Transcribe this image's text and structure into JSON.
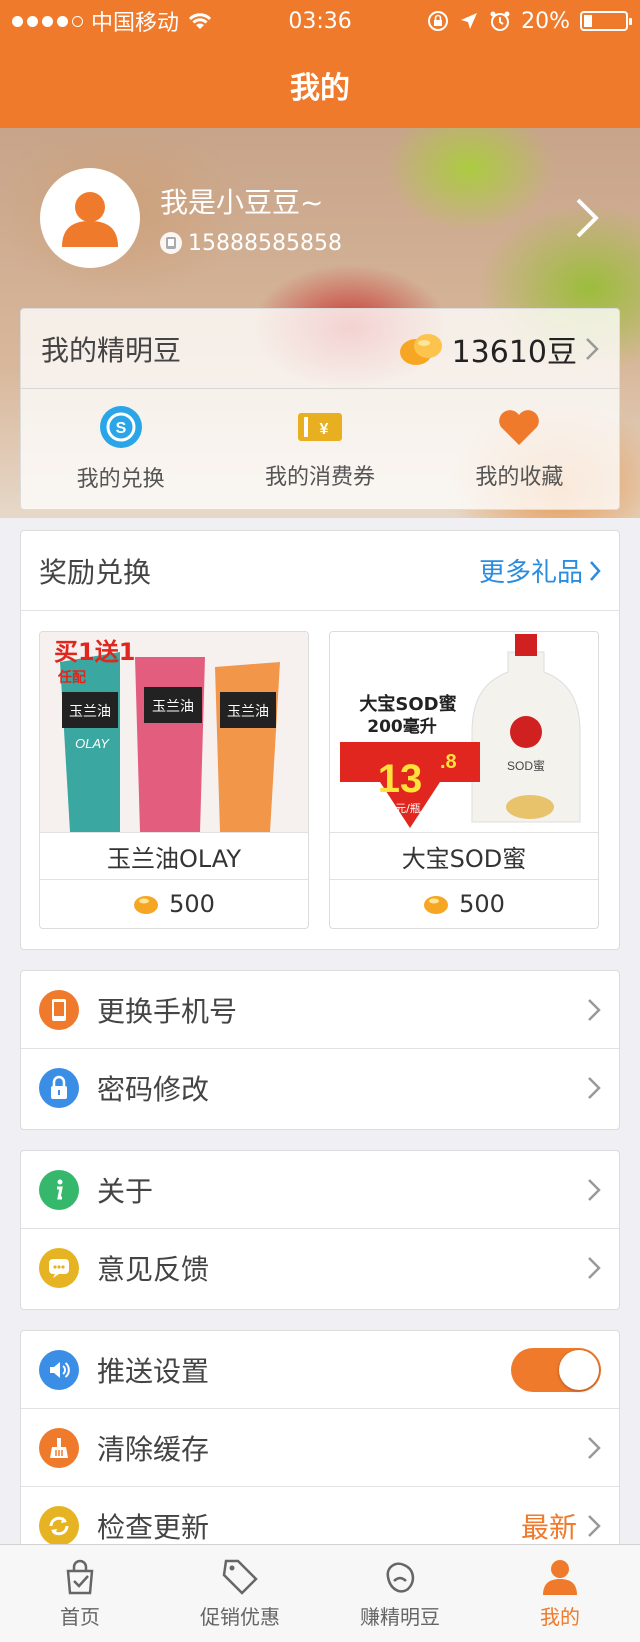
{
  "status": {
    "carrier": "中国移动",
    "time": "03:36",
    "battery": "20%",
    "battery_level": 0.2
  },
  "nav": {
    "title": "我的"
  },
  "profile": {
    "name": "我是小豆豆~",
    "phone": "15888585858"
  },
  "beans": {
    "label": "我的精明豆",
    "amount": "13610豆",
    "actions": [
      {
        "label": "我的兑换",
        "icon": "exchange-icon"
      },
      {
        "label": "我的消费券",
        "icon": "coupon-icon"
      },
      {
        "label": "我的收藏",
        "icon": "heart-icon"
      }
    ]
  },
  "rewards": {
    "title": "奖励兑换",
    "more": "更多礼品",
    "items": [
      {
        "name": "玉兰油OLAY",
        "price": "500",
        "promo": "买1送1",
        "promo_sub": "任配",
        "product_label": "玉兰油",
        "brand": "OLAY"
      },
      {
        "name": "大宝SOD蜜",
        "price": "500",
        "promo": "大宝SOD蜜",
        "promo_sub": "200毫升",
        "price_tag": "13",
        "price_tag_small": ".8",
        "price_unit": "元/瓶",
        "product_label": "SOD蜜"
      }
    ]
  },
  "settings": {
    "group1": [
      {
        "label": "更换手机号",
        "icon": "phone-icon",
        "color": "#f07a2b"
      },
      {
        "label": "密码修改",
        "icon": "lock-icon",
        "color": "#3a8ee6"
      }
    ],
    "group2": [
      {
        "label": "关于",
        "icon": "info-icon",
        "color": "#35b86b"
      },
      {
        "label": "意见反馈",
        "icon": "feedback-icon",
        "color": "#e6b422"
      }
    ],
    "group3": [
      {
        "label": "推送设置",
        "icon": "speaker-icon",
        "color": "#3a8ee6",
        "toggle_on": true
      },
      {
        "label": "清除缓存",
        "icon": "broom-icon",
        "color": "#f07a2b"
      },
      {
        "label": "检查更新",
        "icon": "refresh-icon",
        "color": "#e6b422",
        "value": "最新"
      }
    ]
  },
  "tabs": [
    {
      "label": "首页",
      "icon": "home-bag-icon"
    },
    {
      "label": "促销优惠",
      "icon": "tag-icon"
    },
    {
      "label": "赚精明豆",
      "icon": "bean-icon"
    },
    {
      "label": "我的",
      "icon": "user-icon",
      "active": true
    }
  ],
  "colors": {
    "accent": "#f07a2b",
    "link": "#2a8de0"
  }
}
